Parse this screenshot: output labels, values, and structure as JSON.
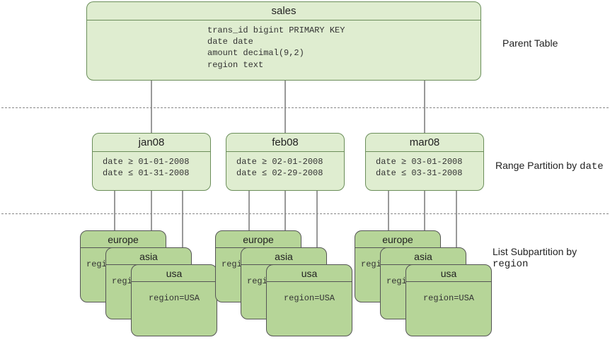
{
  "diagram": {
    "levels": {
      "parent_label": "Parent Table",
      "range_label_prefix": "Range Partition by ",
      "range_label_code": "date",
      "list_label_prefix": "List Subpartition by ",
      "list_label_code": "region"
    },
    "parent": {
      "title": "sales",
      "columns": [
        "trans_id bigint PRIMARY KEY",
        "date date",
        "amount decimal(9,2)",
        "region text"
      ]
    },
    "partitions": [
      {
        "id": "jan",
        "title": "jan08",
        "constraints": [
          "date ≥ 01-01-2008",
          "date ≤ 01-31-2008"
        ]
      },
      {
        "id": "feb",
        "title": "feb08",
        "constraints": [
          "date ≥ 02-01-2008",
          "date ≤ 02-29-2008"
        ]
      },
      {
        "id": "mar",
        "title": "mar08",
        "constraints": [
          "date ≥ 03-01-2008",
          "date ≤ 03-31-2008"
        ]
      }
    ],
    "subpartitions_template": [
      {
        "title": "europe",
        "body": "regi"
      },
      {
        "title": "asia",
        "body": "regi"
      },
      {
        "title": "usa",
        "body": "region=USA"
      }
    ]
  }
}
